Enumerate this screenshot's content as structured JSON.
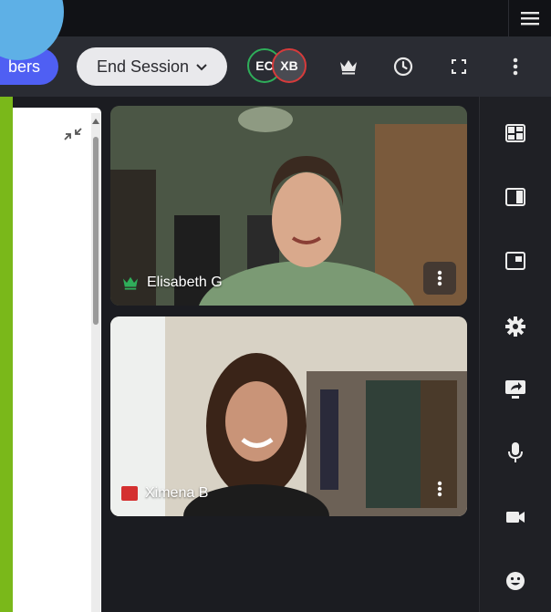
{
  "toolbar": {
    "members_label": "Members",
    "members_visible_label": "bers",
    "end_session_label": "End Session",
    "avatars": [
      {
        "initials": "EC",
        "ring_color": "#2fae5a"
      },
      {
        "initials": "XB",
        "ring_color": "#d63b3b"
      }
    ],
    "icons": [
      "crown-icon",
      "clock-icon",
      "fullscreen-icon",
      "more-vertical-icon"
    ]
  },
  "topbar": {
    "menu_icon": "hamburger-menu-icon"
  },
  "participants": [
    {
      "name": "Elisabeth G",
      "badge": "crown",
      "badge_color": "#2fae5a"
    },
    {
      "name": "Ximena B",
      "badge": "muted-square",
      "badge_color": "#d43030"
    }
  ],
  "sidebar": {
    "icons": [
      "grid-layout-icon",
      "sidebar-layout-icon",
      "picture-in-picture-icon",
      "settings-icon",
      "screen-share-icon",
      "microphone-icon",
      "camera-icon",
      "emoji-icon"
    ]
  },
  "colors": {
    "accent": "#4f5ff3",
    "green_strip": "#7ab81a",
    "blue_circle": "#5eb0e6",
    "background": "#1b1c21"
  }
}
